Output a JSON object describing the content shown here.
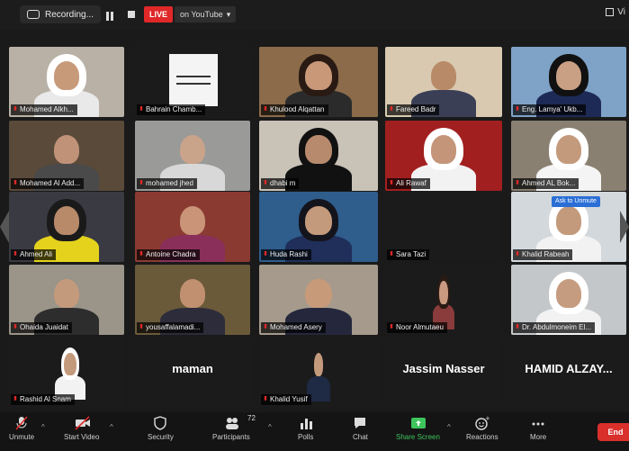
{
  "topbar": {
    "recording_label": "Recording...",
    "live_label": "LIVE",
    "live_target": "on YouTube",
    "view_label": "Vi"
  },
  "participants": [
    {
      "name": "Mohamed Alkh..."
    },
    {
      "name": "Bahrain Chamb..."
    },
    {
      "name": "Khulood Alqattan"
    },
    {
      "name": "Fareed Badr"
    },
    {
      "name": "Eng. Lamya' Ukb..."
    },
    {
      "name": "Mohamed Al Add..."
    },
    {
      "name": "mohamed jhed"
    },
    {
      "name": "dhabi m"
    },
    {
      "name": "Ali Rawaf"
    },
    {
      "name": "Ahmed AL Bok..."
    },
    {
      "name": "Ahmed Ali"
    },
    {
      "name": "Antoine Chadra"
    },
    {
      "name": "Huda Rashi"
    },
    {
      "name": "Sara Tazi"
    },
    {
      "name": "Khalid Rabeah"
    },
    {
      "name": "Ohaida Juaidat"
    },
    {
      "name": "yousaffalamadi..."
    },
    {
      "name": "Mohamed Asery"
    },
    {
      "name": "Noor Almutaeu"
    },
    {
      "name": "Dr. Abdulmoneim El..."
    },
    {
      "name": "Rashid Al Snam"
    },
    {
      "name": "maman",
      "big": "maman"
    },
    {
      "name": "Khalid Yusif"
    },
    {
      "name": "Jassim Nasser",
      "big": "Jassim Nasser"
    },
    {
      "name": "HAMID ALZAY...",
      "big": "HAMID ALZAY..."
    }
  ],
  "ask_badge": "Ask to Unmute",
  "toolbar": {
    "unmute": "Unmute",
    "start_video": "Start Video",
    "security": "Security",
    "participants": "Participants",
    "participants_count": "72",
    "polls": "Polls",
    "chat": "Chat",
    "share_screen": "Share Screen",
    "reactions": "Reactions",
    "more": "More",
    "end": "End"
  },
  "colors": {
    "live_red": "#e02828",
    "active_speaker": "#9bd34a",
    "share_green": "#3ec45c",
    "end_red": "#d9302c"
  }
}
